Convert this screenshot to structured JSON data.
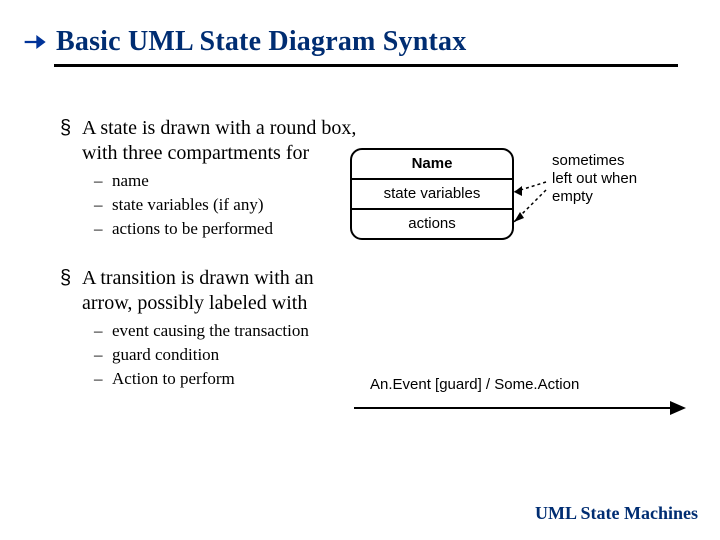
{
  "title": "Basic UML State Diagram Syntax",
  "bullets": {
    "b1": "A state is drawn with a round box, with three compartments for",
    "b1s": [
      "name",
      "state variables (if any)",
      "actions to be performed"
    ],
    "b2": "A transition is drawn with an arrow, possibly labeled with",
    "b2s": [
      "event causing the transaction",
      "guard condition",
      "Action to perform"
    ]
  },
  "state_box": {
    "row1": "Name",
    "row2": "state variables",
    "row3": "actions",
    "annotation": "sometimes\nleft out when\nempty"
  },
  "transition_label": "An.Event [guard] / Some.Action",
  "footer": "UML State Machines"
}
